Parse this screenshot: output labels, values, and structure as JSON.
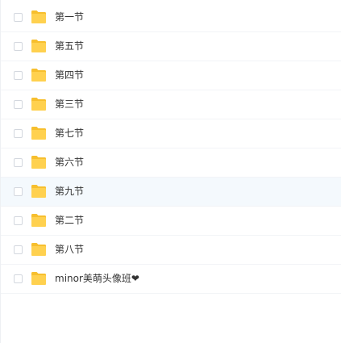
{
  "files": [
    {
      "name": "第一节",
      "type": "folder-icon"
    },
    {
      "name": "第五节",
      "type": "folder-icon"
    },
    {
      "name": "第四节",
      "type": "folder-icon"
    },
    {
      "name": "第三节",
      "type": "folder-icon"
    },
    {
      "name": "第七节",
      "type": "folder-icon"
    },
    {
      "name": "第六节",
      "type": "folder-icon"
    },
    {
      "name": "第九节",
      "type": "folder-icon"
    },
    {
      "name": "第二节",
      "type": "folder-icon"
    },
    {
      "name": "第八节",
      "type": "folder-icon"
    },
    {
      "name": "minor美萌头像班❤",
      "type": "folder-icon"
    }
  ],
  "colors": {
    "folder": "#ffd14f",
    "folder_tab": "#f7bf2e",
    "hover_row": "#f4f9fd",
    "text": "#333333"
  }
}
